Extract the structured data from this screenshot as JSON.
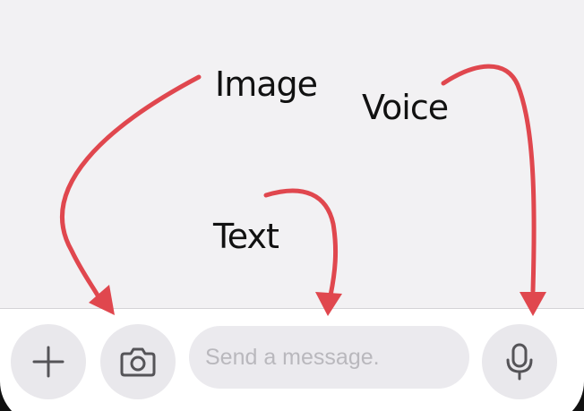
{
  "annotations": {
    "image_label": "Image",
    "voice_label": "Voice",
    "text_label": "Text",
    "arrow_color": "#e0474e"
  },
  "composer": {
    "plus_icon": "plus-icon",
    "camera_icon": "camera-icon",
    "input_placeholder": "Send a message.",
    "input_value": "",
    "mic_icon": "microphone-icon"
  }
}
